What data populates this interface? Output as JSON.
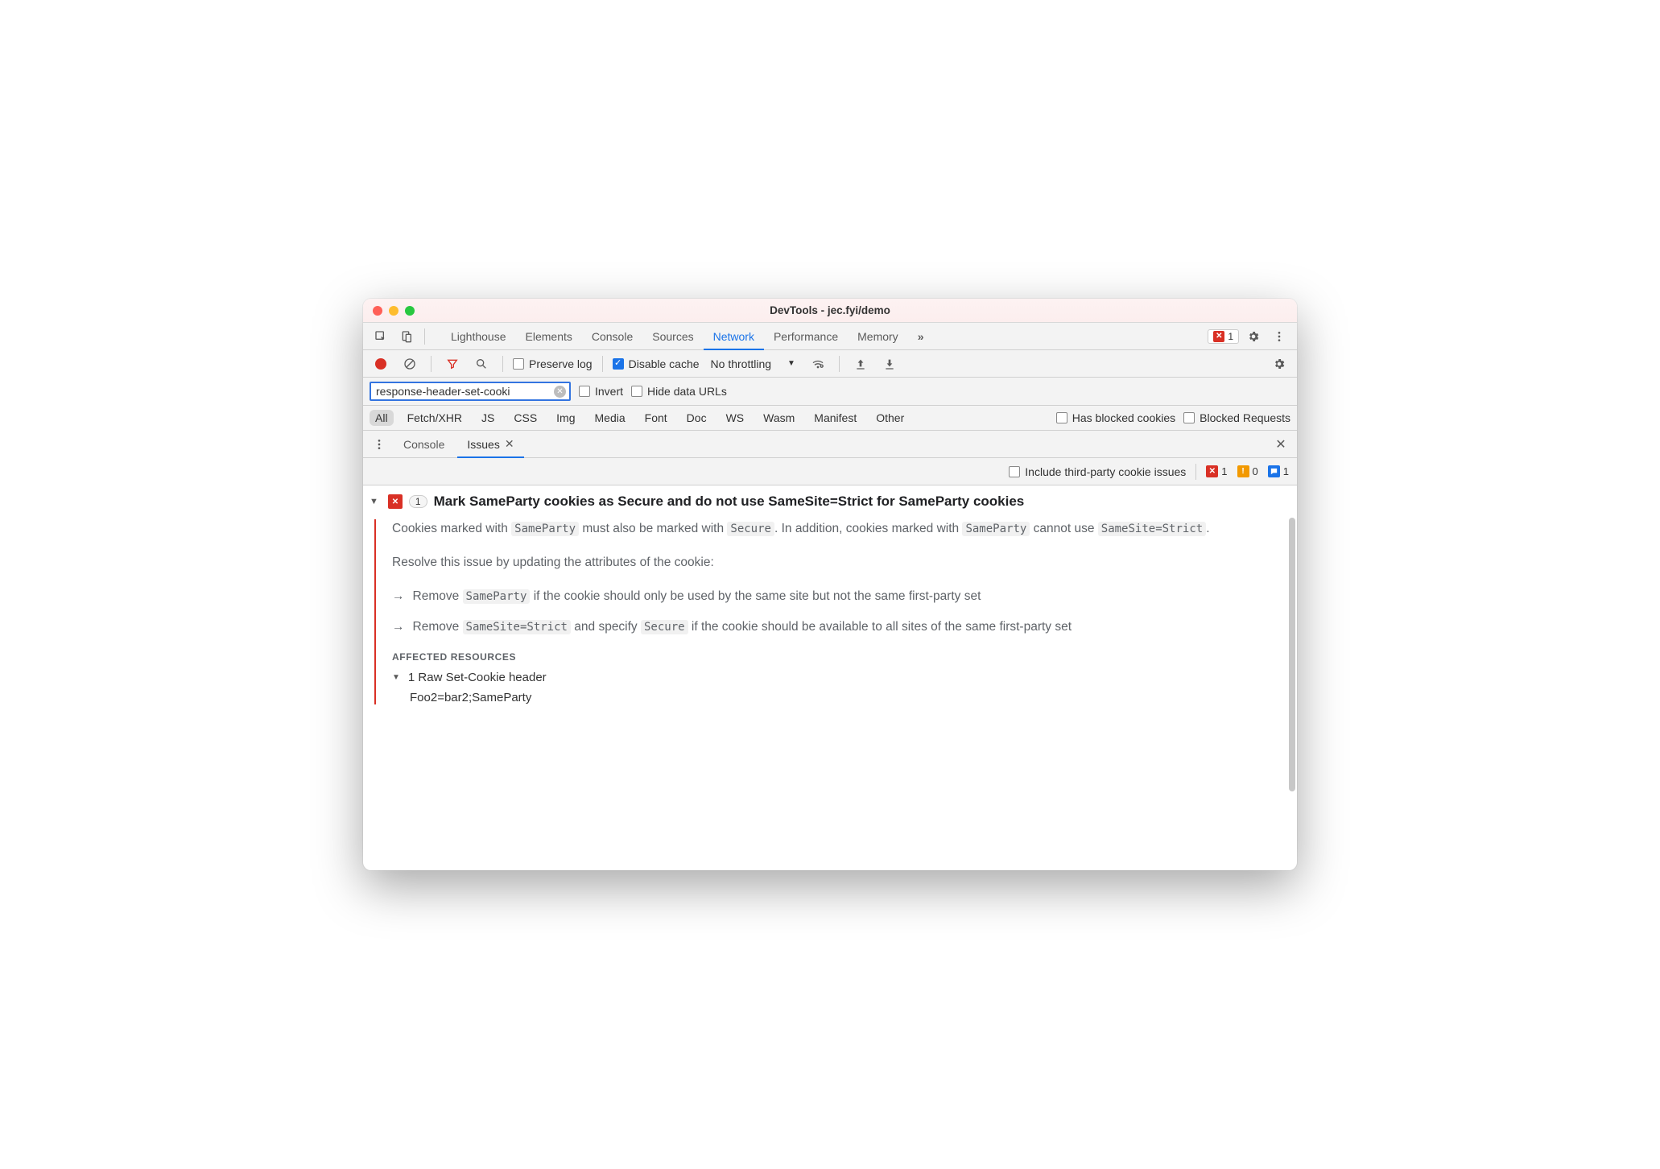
{
  "window": {
    "title": "DevTools - jec.fyi/demo"
  },
  "mainTabs": {
    "items": [
      "Lighthouse",
      "Elements",
      "Console",
      "Sources",
      "Network",
      "Performance",
      "Memory"
    ],
    "active": "Network",
    "overflow_icon": "»",
    "error_count": "1"
  },
  "netToolbar": {
    "preserve_log": "Preserve log",
    "preserve_log_checked": false,
    "disable_cache": "Disable cache",
    "disable_cache_checked": true,
    "throttling": "No throttling"
  },
  "filterBar": {
    "filter_value": "response-header-set-cooki",
    "invert": "Invert",
    "hide_data_urls": "Hide data URLs"
  },
  "typeFilters": {
    "items": [
      "All",
      "Fetch/XHR",
      "JS",
      "CSS",
      "Img",
      "Media",
      "Font",
      "Doc",
      "WS",
      "Wasm",
      "Manifest",
      "Other"
    ],
    "selected": "All",
    "has_blocked": "Has blocked cookies",
    "blocked_requests": "Blocked Requests"
  },
  "drawer": {
    "tabs": [
      "Console",
      "Issues"
    ],
    "active": "Issues"
  },
  "issuesToolbar": {
    "include_third_party": "Include third-party cookie issues",
    "counts": {
      "error": "1",
      "warning": "0",
      "info": "1"
    }
  },
  "issue": {
    "count": "1",
    "title": "Mark SameParty cookies as Secure and do not use SameSite=Strict for SameParty cookies",
    "desc1_a": "Cookies marked with ",
    "desc1_code1": "SameParty",
    "desc1_b": " must also be marked with ",
    "desc1_code2": "Secure",
    "desc1_c": ". In addition, cookies marked with ",
    "desc1_code3": "SameParty",
    "desc1_d": " cannot use ",
    "desc1_code4": "SameSite=Strict",
    "desc1_e": ".",
    "desc2": "Resolve this issue by updating the attributes of the cookie:",
    "bullet1_a": "Remove ",
    "bullet1_code": "SameParty",
    "bullet1_b": " if the cookie should only be used by the same site but not the same first-party set",
    "bullet2_a": "Remove ",
    "bullet2_code1": "SameSite=Strict",
    "bullet2_b": " and specify ",
    "bullet2_code2": "Secure",
    "bullet2_c": " if the cookie should be available to all sites of the same first-party set",
    "affected_label": "AFFECTED RESOURCES",
    "affected_header": "1 Raw Set-Cookie header",
    "affected_value": "Foo2=bar2;SameParty"
  }
}
